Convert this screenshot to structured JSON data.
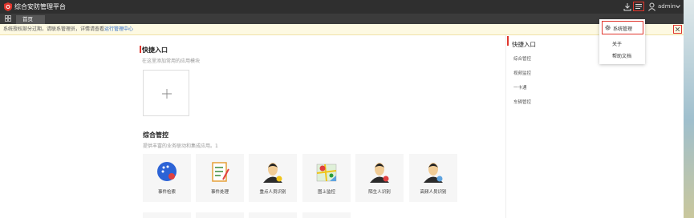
{
  "header": {
    "app_title": "综合安防管理平台",
    "user": "admin",
    "icons": [
      "shield-logo-icon",
      "download-icon",
      "menu-icon",
      "user-icon",
      "chevron-down-icon"
    ]
  },
  "tabs": [
    {
      "label": "首页",
      "active": true
    }
  ],
  "notice": {
    "text": "系统授权部分过期，请联系管理员，详情请查看",
    "link": "运行管理中心"
  },
  "quick_entry": {
    "title": "快捷入口",
    "subtitle": "在这里添加常用的应用模块"
  },
  "integrated": {
    "title": "综合管控",
    "subtitle": "提供丰富的业务联动和集成应用。1",
    "cards": [
      "事件检索",
      "事件处理",
      "重点人员识别",
      "图上监控",
      "陌生人识别",
      "高频人员识别"
    ]
  },
  "right_panel": {
    "title": "快捷入口",
    "items": [
      "综合管控",
      "视频监控",
      "一卡通",
      "车辆管控"
    ]
  },
  "dropdown": {
    "items": [
      "系统管理",
      "关于",
      "帮助文档"
    ]
  },
  "colors": {
    "accent": "#e0362d",
    "header_bg": "#2f2f2f",
    "link": "#2a68c8"
  }
}
